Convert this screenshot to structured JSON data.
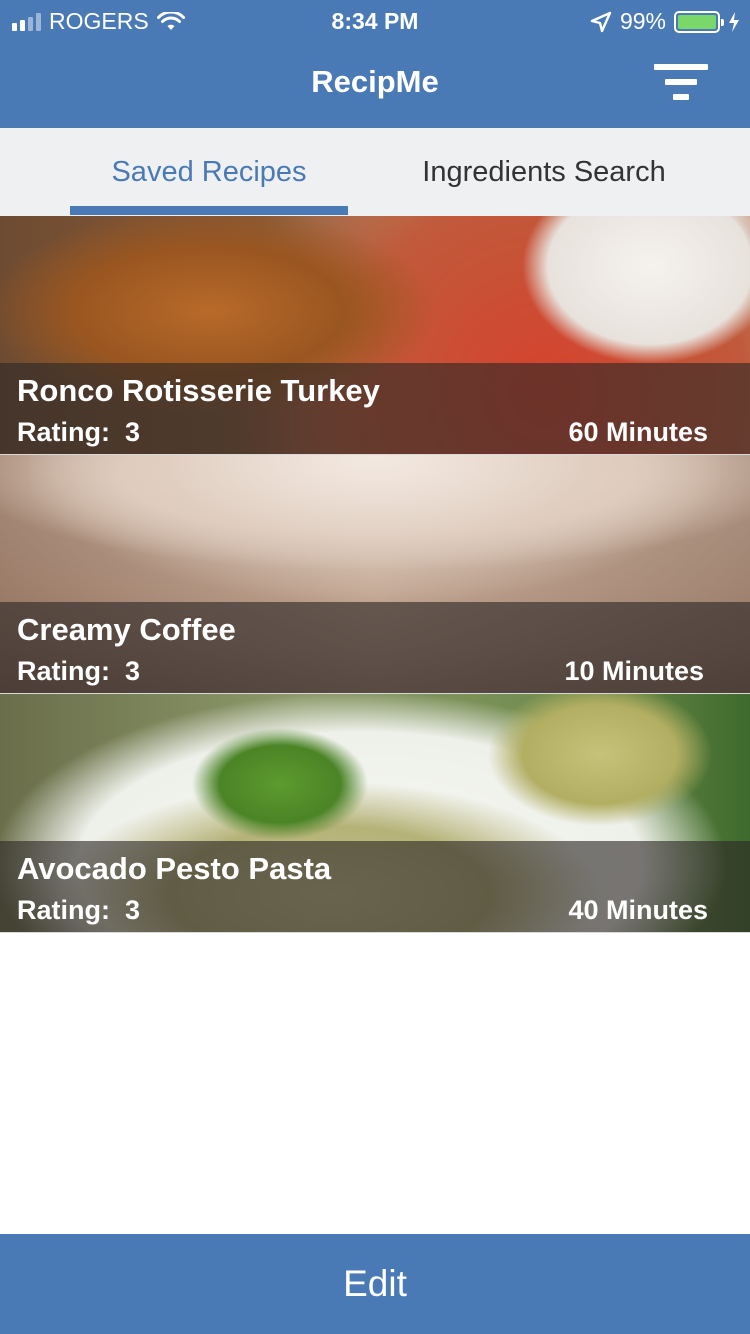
{
  "status_bar": {
    "carrier": "ROGERS",
    "time": "8:34 PM",
    "battery_percent": "99%",
    "battery_level": 0.99,
    "battery_color": "#7ad86b"
  },
  "nav": {
    "title": "RecipMe",
    "filter_icon": "filter-icon"
  },
  "tabs": [
    {
      "label": "Saved Recipes",
      "active": true
    },
    {
      "label": "Ingredients Search",
      "active": false
    }
  ],
  "recipes": [
    {
      "name": "Ronco Rotisserie Turkey",
      "rating_label": "Rating:",
      "rating": "3",
      "time": "60 Minutes"
    },
    {
      "name": "Creamy Coffee",
      "rating_label": "Rating:",
      "rating": "3",
      "time": "10 Minutes"
    },
    {
      "name": "Avocado Pesto Pasta",
      "rating_label": "Rating:",
      "rating": "3",
      "time": "40 Minutes"
    }
  ],
  "bottom_bar": {
    "label": "Edit"
  },
  "colors": {
    "accent": "#4a7ab6",
    "tab_bar_bg": "#eff0f2",
    "inactive_tab_text": "#333333"
  }
}
